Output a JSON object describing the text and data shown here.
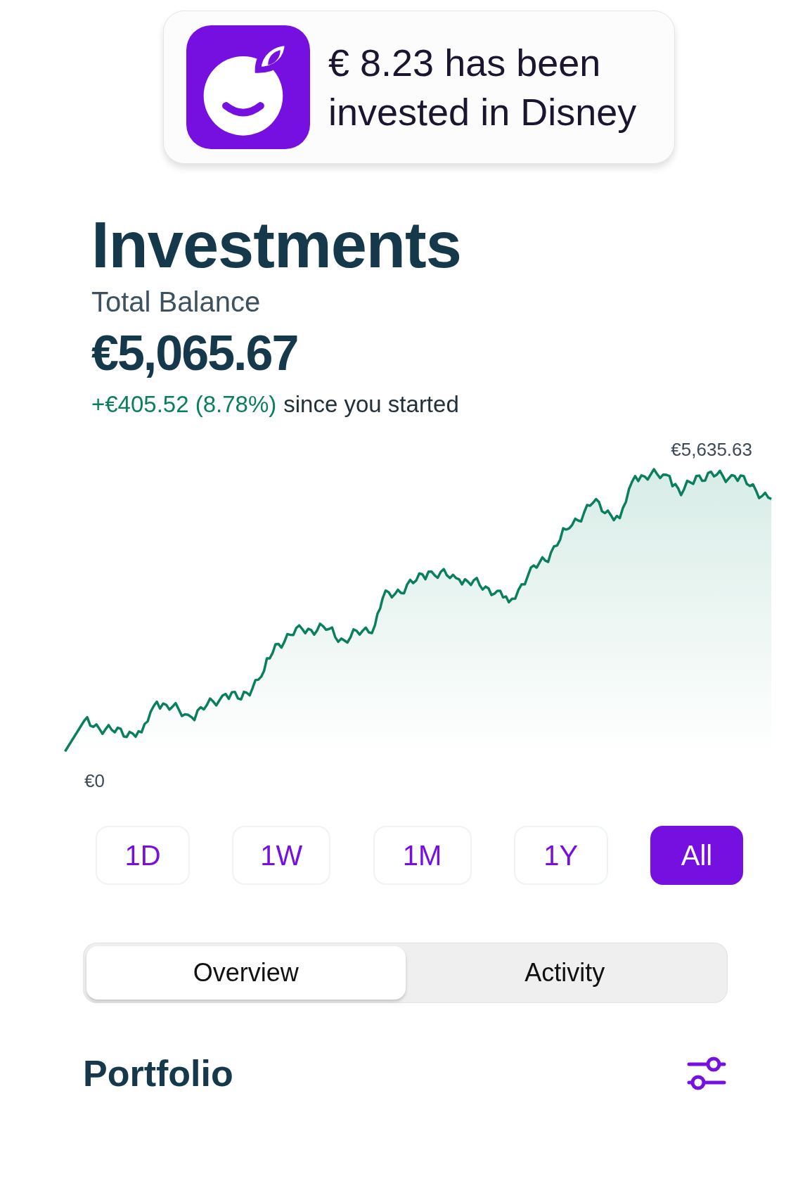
{
  "notification": {
    "message": "€ 8.23 has been invested in Disney"
  },
  "header": {
    "title": "Investments",
    "balance_label": "Total Balance",
    "balance": "€5,065.67",
    "change": "+€405.52 (8.78%)",
    "change_suffix": "since you started"
  },
  "chart": {
    "max_label": "€5,635.63",
    "min_label": "€0"
  },
  "periods": [
    {
      "label": "1D",
      "selected": false
    },
    {
      "label": "1W",
      "selected": false
    },
    {
      "label": "1M",
      "selected": false
    },
    {
      "label": "1Y",
      "selected": false
    },
    {
      "label": "All",
      "selected": true
    }
  ],
  "tabs": [
    {
      "label": "Overview",
      "selected": true
    },
    {
      "label": "Activity",
      "selected": false
    }
  ],
  "section": {
    "title": "Portfolio"
  }
}
